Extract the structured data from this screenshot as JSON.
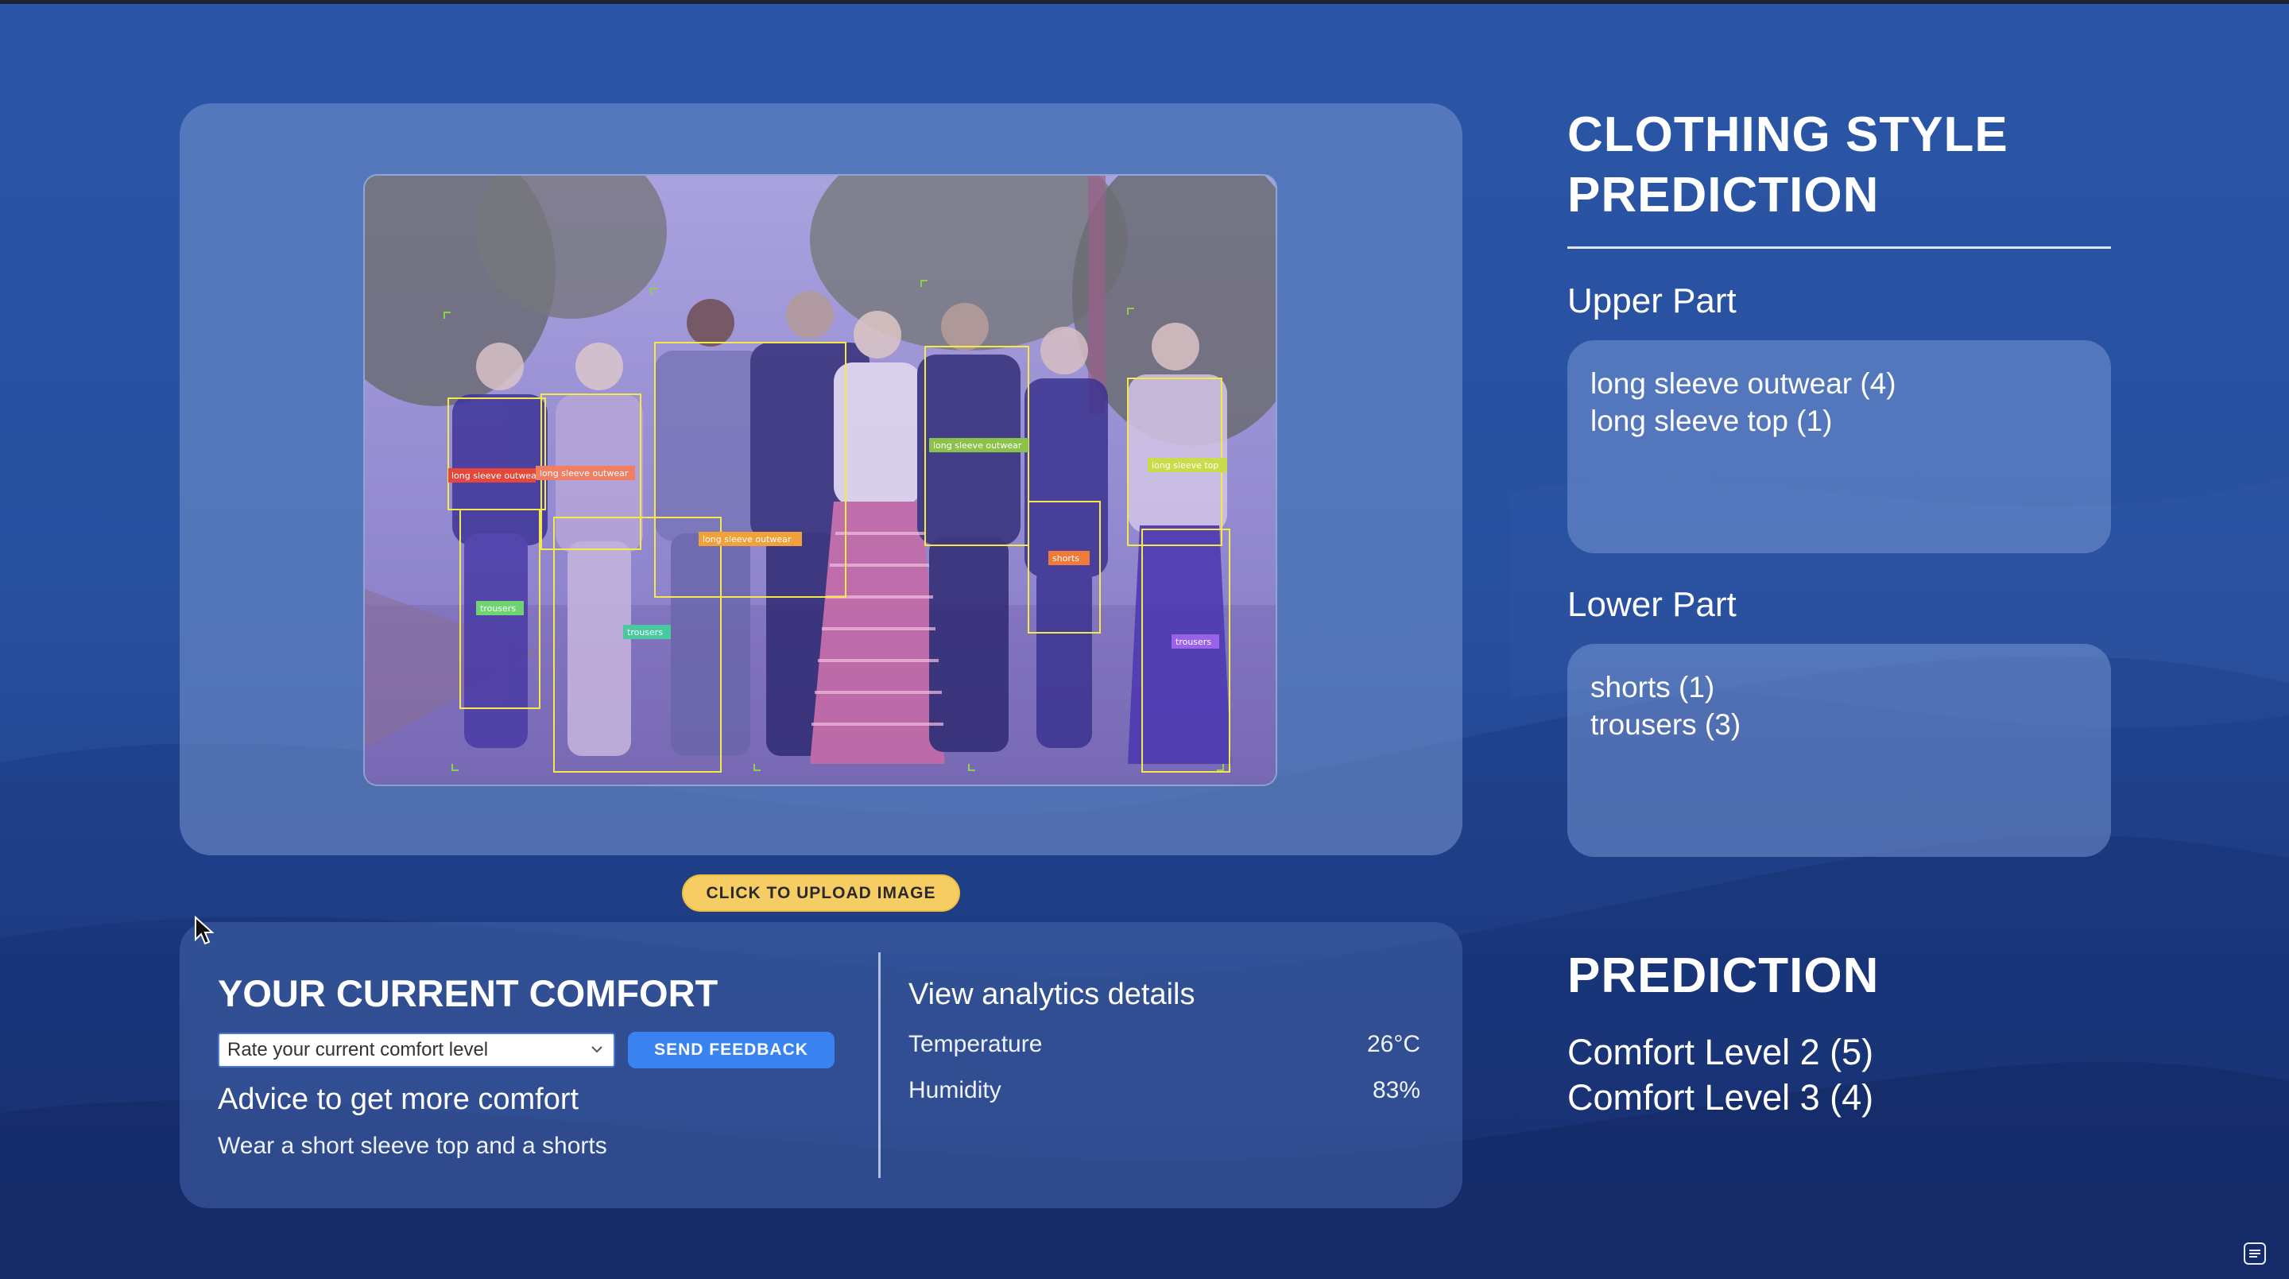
{
  "upload": {
    "label": "CLICK TO UPLOAD IMAGE"
  },
  "detections": [
    {
      "label": "long sleeve outwear",
      "color": "#e5473b"
    },
    {
      "label": "long sleeve outwear",
      "color": "#f07e62"
    },
    {
      "label": "long sleeve outwear",
      "color": "#f0a13a"
    },
    {
      "label": "long sleeve outwear",
      "color": "#8bc34a"
    },
    {
      "label": "long sleeve top",
      "color": "#c9dd4a"
    },
    {
      "label": "shorts",
      "color": "#f07a3a"
    },
    {
      "label": "trousers",
      "color": "#6fd36f"
    },
    {
      "label": "trousers",
      "color": "#48c9a0"
    },
    {
      "label": "trousers",
      "color": "#9a62e8"
    }
  ],
  "comfort": {
    "title": "YOUR CURRENT COMFORT",
    "select_value": "Rate your current comfort level",
    "feedback_label": "SEND FEEDBACK",
    "advice_title": "Advice to get more comfort",
    "advice_text": "Wear a short sleeve top and a shorts"
  },
  "analytics": {
    "link_label": "View analytics details",
    "temperature_label": "Temperature",
    "temperature_value": "26°C",
    "humidity_label": "Humidity",
    "humidity_value": "83%"
  },
  "style_prediction": {
    "title_line1": "CLOTHING STYLE",
    "title_line2": "PREDICTION",
    "upper_label": "Upper Part",
    "upper_items": [
      "long sleeve outwear (4)",
      "long sleeve top (1)"
    ],
    "lower_label": "Lower Part",
    "lower_items": [
      "shorts (1)",
      "trousers (3)"
    ]
  },
  "prediction": {
    "title": "PREDICTION",
    "items": [
      "Comfort Level 2 (5)",
      "Comfort Level 3 (4)"
    ]
  },
  "colors": {
    "accent_yellow": "#f6cd62",
    "button_blue": "#3a82f0",
    "box_yellow": "#f5e94a"
  }
}
